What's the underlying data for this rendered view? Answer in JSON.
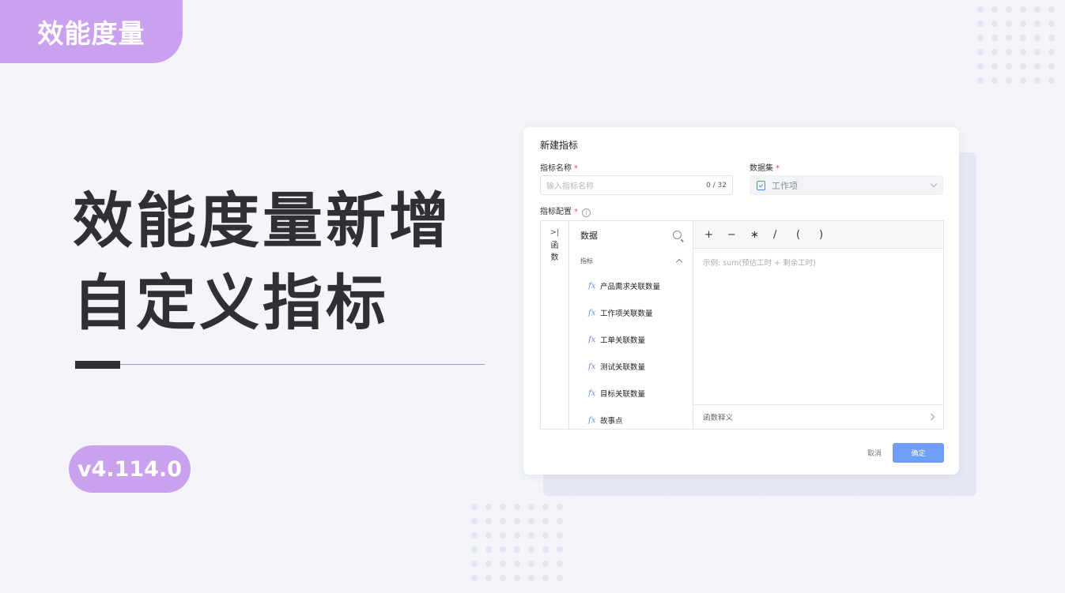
{
  "banner": {
    "tag": "效能度量",
    "title_line1": "效能度量新增",
    "title_line2": "自定义指标",
    "version": "v4.114.0"
  },
  "dialog": {
    "title": "新建指标",
    "name_label": "指标名称",
    "name_placeholder": "输入指标名称",
    "name_counter": "0 / 32",
    "dataset_label": "数据集",
    "dataset_value": "工作项",
    "config_label": "指标配置",
    "required_mark": "*",
    "functions_collapse": ">|",
    "functions_label": "函数",
    "data_label": "数据",
    "group_label": "指标",
    "items": [
      "产品需求关联数量",
      "工作项关联数量",
      "工单关联数量",
      "测试关联数量",
      "目标关联数量",
      "故事点"
    ],
    "fx_glyph": "fx",
    "operators": [
      "+",
      "−",
      "∗",
      "/",
      "(",
      ")"
    ],
    "editor_placeholder": "示例: sum(预估工时 + 剩余工时)",
    "function_desc": "函数释义",
    "cancel": "取消",
    "confirm": "确定"
  },
  "colors": {
    "accent_purple": "#c9a1ee",
    "primary_blue": "#6f9ef8",
    "title_text": "#2f2f35"
  }
}
